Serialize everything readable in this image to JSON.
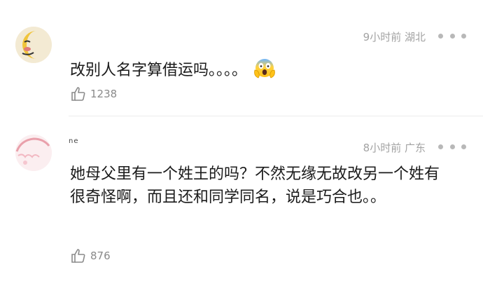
{
  "comments": [
    {
      "username": "",
      "time": "9小时前",
      "location": "湖北",
      "text": "改别人名字算借运吗。。。。",
      "emoji": "screaming-face-emoji",
      "likes": "1238"
    },
    {
      "username": "ne",
      "time": "8小时前",
      "location": "广东",
      "text": "她母父里有一个姓王的吗？不然无缘无故改另一个姓有很奇怪啊，而且还和同学同名，说是巧合也。。",
      "likes": "876"
    }
  ]
}
